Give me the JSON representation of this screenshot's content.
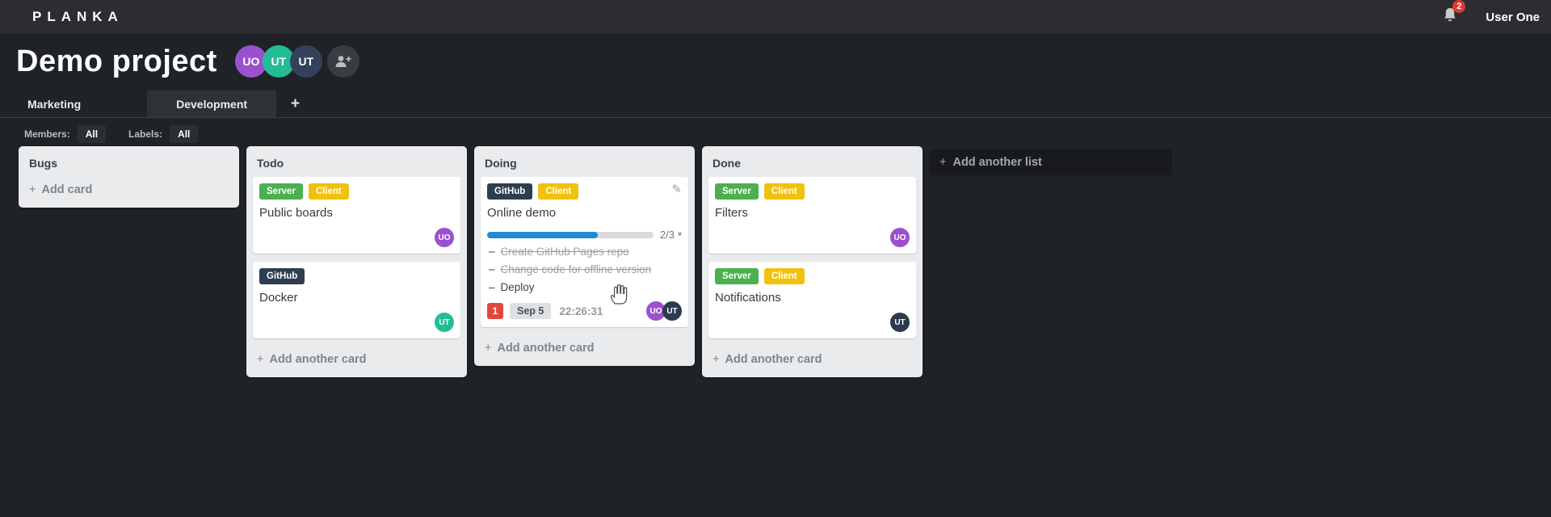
{
  "topbar": {
    "logo": "PLANKA",
    "notifications_count": "2",
    "user_name": "User One"
  },
  "project": {
    "title": "Demo project",
    "members": [
      {
        "initials": "UO",
        "color": "#9b51cf"
      },
      {
        "initials": "UT",
        "color": "#22bd96"
      },
      {
        "initials": "UT",
        "color": "#33425a"
      }
    ]
  },
  "tabs": {
    "items": [
      {
        "label": "Marketing",
        "active": false
      },
      {
        "label": "Development",
        "active": true
      }
    ],
    "add_label": "+"
  },
  "filters": {
    "members_label": "Members:",
    "members_value": "All",
    "labels_label": "Labels:",
    "labels_value": "All"
  },
  "board": {
    "add_list_label": "Add another list",
    "lists": [
      {
        "title": "Bugs",
        "add_card_label": "Add card",
        "cards": []
      },
      {
        "title": "Todo",
        "add_card_label": "Add another card",
        "cards": [
          {
            "title": "Public boards",
            "labels": [
              {
                "text": "Server",
                "color": "#4caf50"
              },
              {
                "text": "Client",
                "color": "#f2c10e"
              }
            ],
            "members": [
              {
                "initials": "UO",
                "color": "#9b51cf"
              }
            ]
          },
          {
            "title": "Docker",
            "labels": [
              {
                "text": "GitHub",
                "color": "#2e3e50"
              }
            ],
            "members": [
              {
                "initials": "UT",
                "color": "#22bd96"
              }
            ]
          }
        ]
      },
      {
        "title": "Doing",
        "add_card_label": "Add another card",
        "cards": [
          {
            "title": "Online demo",
            "editable": true,
            "labels": [
              {
                "text": "GitHub",
                "color": "#2e3e50"
              },
              {
                "text": "Client",
                "color": "#f2c10e"
              }
            ],
            "progress": {
              "completed": 2,
              "total": 3,
              "text": "2/3",
              "percent": 66.7,
              "color": "#2189d5"
            },
            "tasks": [
              {
                "text": "Create GitHub Pages repo",
                "done": true
              },
              {
                "text": "Change code for offline version",
                "done": true
              },
              {
                "text": "Deploy",
                "done": false
              }
            ],
            "notification_count": "1",
            "due_date": "Sep 5",
            "timer": "22:26:31",
            "members": [
              {
                "initials": "UO",
                "color": "#9b51cf"
              },
              {
                "initials": "UT",
                "color": "#2c3a4e"
              }
            ]
          }
        ]
      },
      {
        "title": "Done",
        "add_card_label": "Add another card",
        "cards": [
          {
            "title": "Filters",
            "labels": [
              {
                "text": "Server",
                "color": "#4caf50"
              },
              {
                "text": "Client",
                "color": "#f2c10e"
              }
            ],
            "members": [
              {
                "initials": "UO",
                "color": "#9b51cf"
              }
            ]
          },
          {
            "title": "Notifications",
            "labels": [
              {
                "text": "Server",
                "color": "#4caf50"
              },
              {
                "text": "Client",
                "color": "#f2c10e"
              }
            ],
            "members": [
              {
                "initials": "UT",
                "color": "#2c3a4e"
              }
            ]
          }
        ]
      }
    ]
  },
  "icons": {
    "plus": "+",
    "edit": "✎",
    "caret_down": "▾",
    "dash": "–"
  },
  "colors": {
    "topbar_bg": "#2b2d31",
    "page_bg": "#1f2226",
    "list_bg": "#e9ebec",
    "card_bg": "#ffffff",
    "badge_red": "#e03a2e",
    "progress_blue": "#2189d5"
  }
}
